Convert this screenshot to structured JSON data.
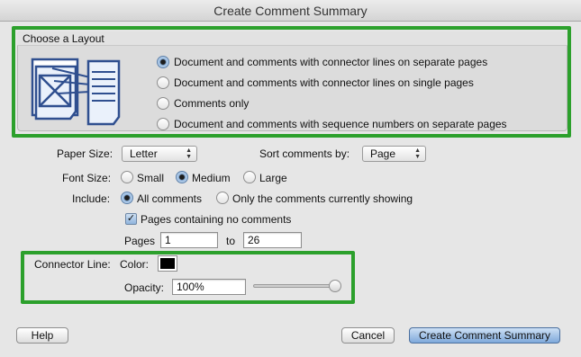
{
  "window": {
    "title": "Create Comment Summary"
  },
  "layout": {
    "group_label": "Choose a Layout",
    "options": [
      {
        "label": "Document and comments with connector lines on separate pages",
        "selected": true
      },
      {
        "label": "Document and comments with connector lines on single pages",
        "selected": false
      },
      {
        "label": "Comments only",
        "selected": false
      },
      {
        "label": "Document and comments with sequence numbers on separate pages",
        "selected": false
      }
    ],
    "preview_icon": "layout-preview-icon"
  },
  "paper_size": {
    "label": "Paper Size:",
    "value": "Letter"
  },
  "sort": {
    "label": "Sort comments by:",
    "value": "Page"
  },
  "font_size": {
    "label": "Font Size:",
    "options": [
      {
        "label": "Small",
        "selected": false
      },
      {
        "label": "Medium",
        "selected": true
      },
      {
        "label": "Large",
        "selected": false
      }
    ]
  },
  "include": {
    "label": "Include:",
    "options": [
      {
        "label": "All comments",
        "selected": true
      },
      {
        "label": "Only the comments currently showing",
        "selected": false
      }
    ]
  },
  "no_comments_pages": {
    "label": "Pages containing no comments",
    "checked": true
  },
  "pages": {
    "label": "Pages",
    "from": "1",
    "to_label": "to",
    "to": "26"
  },
  "connector": {
    "label": "Connector Line:",
    "color_label": "Color:",
    "color": "#000000",
    "opacity_label": "Opacity:",
    "opacity_value": "100%",
    "opacity_fraction": 1.0
  },
  "buttons": {
    "help": "Help",
    "cancel": "Cancel",
    "create": "Create Comment Summary"
  },
  "colors": {
    "highlight": "#2ca02c",
    "default_button": "#7fa9db"
  }
}
